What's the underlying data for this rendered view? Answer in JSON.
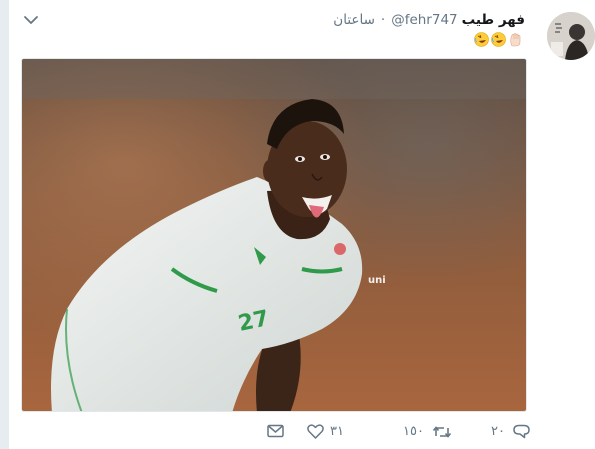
{
  "tweet": {
    "display_name": "فهر طيب",
    "handle": "@fehr747",
    "separator": "·",
    "time": "ساعتان",
    "text_emojis": [
      "raised-hand",
      "rolling-laughing",
      "rolling-laughing"
    ],
    "media_watermark": "uni"
  },
  "actions": {
    "replies": "٢٠",
    "retweets": "١٥٠",
    "likes": "٣١"
  },
  "icons": {
    "menu": "chevron-down-icon",
    "reply": "reply-icon",
    "retweet": "retweet-icon",
    "like": "heart-icon",
    "message": "envelope-icon"
  },
  "colors": {
    "text_primary": "#14171a",
    "text_secondary": "#657786",
    "rail": "#e6ecf0"
  }
}
